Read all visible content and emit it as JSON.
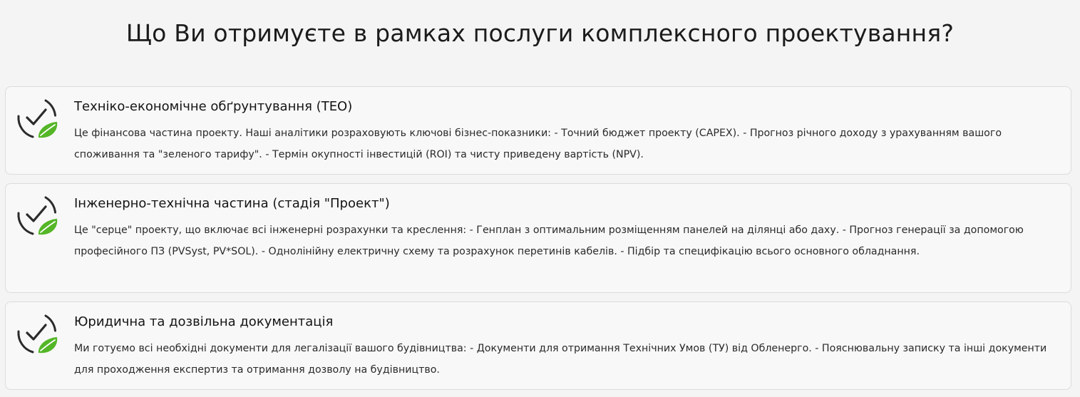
{
  "section": {
    "title": "Що Ви отримуєте в рамках послуги комплексного проектування?"
  },
  "colors": {
    "accent": "#54b627",
    "icon_stroke": "#2b2b2b",
    "card_border": "#dcdcdc"
  },
  "cards": [
    {
      "icon": "check-leaf-icon",
      "title": "Техніко-економічне обґрунтування (ТЕО)",
      "text": "Це фінансова частина проекту. Наші аналітики розраховують ключові бізнес-показники: - Точний бюджет проекту (CAPEX). - Прогноз річного доходу з урахуванням вашого споживання та \"зеленого тарифу\". - Термін окупності інвестицій (ROI) та чисту приведену вартість (NPV)."
    },
    {
      "icon": "check-leaf-icon",
      "title": "Інженерно-технічна частина (стадія \"Проект\")",
      "text": "Це \"серце\" проекту, що включає всі інженерні розрахунки та креслення: - Генплан з оптимальним розміщенням панелей на ділянці або даху. - Прогноз генерації за допомогою професійного ПЗ (PVSyst, PV*SOL). - Однолінійну електричну схему та розрахунок перетинів кабелів. - Підбір та специфікацію всього основного обладнання."
    },
    {
      "icon": "check-leaf-icon",
      "title": "Юридична та дозвільна документація",
      "text": "Ми готуємо всі необхідні документи для легалізації вашого будівництва: - Документи для отримання Технічних Умов (ТУ) від Обленерго. - Пояснювальну записку та інші документи для проходження експертиз та отримання дозволу на будівництво."
    }
  ]
}
